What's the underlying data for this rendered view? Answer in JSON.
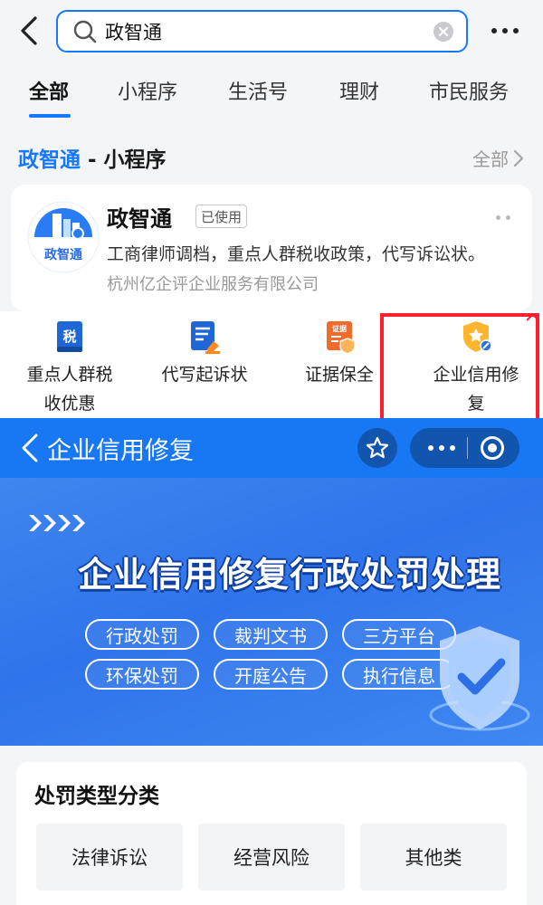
{
  "search": {
    "query": "政智通"
  },
  "tabs": [
    {
      "label": "全部",
      "active": true
    },
    {
      "label": "小程序"
    },
    {
      "label": "生活号"
    },
    {
      "label": "理财"
    },
    {
      "label": "市民服务"
    }
  ],
  "section": {
    "brand": "政智通",
    "suffix": " - 小程序",
    "more": "全部"
  },
  "app": {
    "name": "政智通",
    "badge": "已使用",
    "logo_text": "政智通",
    "description": "工商律师调档，重点人群税收政策，代写诉讼状。",
    "company": "杭州亿企评企业服务有限公司"
  },
  "services": [
    {
      "label": "重点人群税收优惠",
      "icon": "tax-icon",
      "icon_text": "税"
    },
    {
      "label": "代写起诉状",
      "icon": "document-pen-icon"
    },
    {
      "label": "证据保全",
      "icon": "evidence-shield-icon",
      "icon_text": "证据"
    },
    {
      "label": "企业信用修复",
      "icon": "credit-shield-icon"
    }
  ],
  "miniprogram": {
    "title": "企业信用修复",
    "banner_title": "企业信用修复行政处罚处理",
    "pills": [
      "行政处罚",
      "裁判文书",
      "三方平台",
      "环保处罚",
      "开庭公告",
      "执行信息"
    ]
  },
  "category": {
    "title": "处罚类型分类",
    "items": [
      "法律诉讼",
      "经营风险",
      "其他类"
    ]
  },
  "colors": {
    "accent": "#1677ff",
    "header_blue": "#1877f2",
    "highlight_red": "#ff1f2f"
  }
}
